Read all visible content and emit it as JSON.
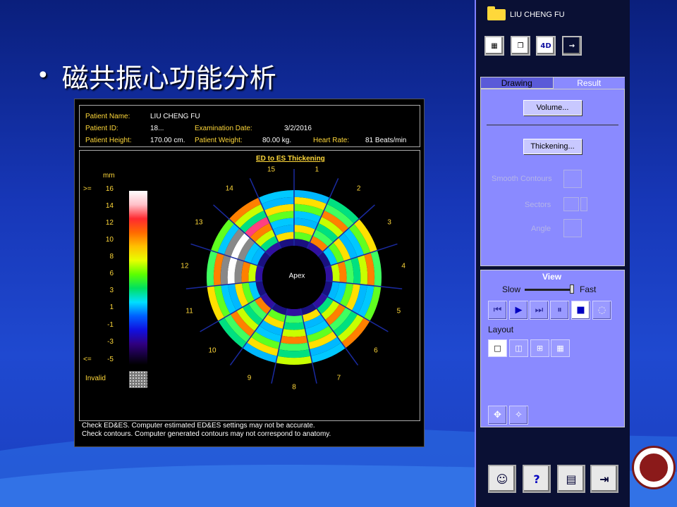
{
  "slide": {
    "title": "磁共振心功能分析"
  },
  "patient_info": {
    "name_label": "Patient Name:",
    "name_value": "LIU CHENG FU",
    "id_label": "Patient ID:",
    "id_value": "18...",
    "exam_label": "Examination Date:",
    "exam_value": "3/2/2016",
    "height_label": "Patient Height:",
    "height_value": "170.00 cm.",
    "weight_label": "Patient Weight:",
    "weight_value": "80.00 kg.",
    "hr_label": "Heart Rate:",
    "hr_value": "81 Beats/min"
  },
  "plot": {
    "title": "ED to ES Thickening",
    "scale_unit": "mm",
    "scale_labels": [
      ">=",
      "16",
      "14",
      "12",
      "10",
      "8",
      "6",
      "3",
      "1",
      "-1",
      "-3",
      "<=",
      "-5"
    ],
    "invalid_label": "Invalid",
    "center_label": "Apex",
    "segments": [
      "1",
      "2",
      "3",
      "4",
      "5",
      "6",
      "7",
      "8",
      "9",
      "10",
      "11",
      "12",
      "13",
      "14",
      "15"
    ]
  },
  "footer": {
    "line1": "Check ED&ES. Computer estimated ED&ES settings may not be accurate.",
    "line2": "Check contours. Computer generated contours may not correspond to anatomy."
  },
  "ctrl": {
    "patient": "LIU CHENG FU",
    "tab_drawing": "Drawing",
    "tab_result": "Result",
    "volume": "Volume...",
    "thickening": "Thickening...",
    "smooth": "Smooth Contours",
    "sectors": "Sectors",
    "angle": "Angle",
    "view": "View",
    "slow": "Slow",
    "fast": "Fast",
    "layout": "Layout",
    "icon_4d": "4D"
  },
  "colors": {
    "accent": "#8a8aff",
    "label": "#ffd83a"
  }
}
